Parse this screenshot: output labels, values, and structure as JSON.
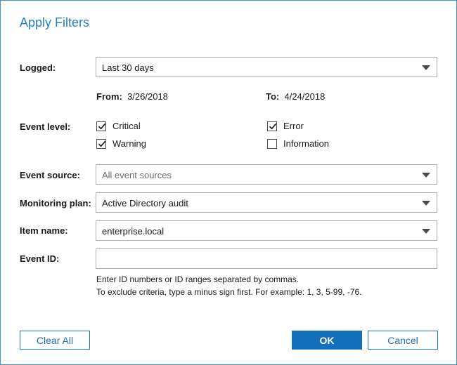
{
  "dialog": {
    "title": "Apply Filters"
  },
  "logged": {
    "label": "Logged:",
    "value": "Last 30 days",
    "from_label": "From:",
    "from_value": "3/26/2018",
    "to_label": "To:",
    "to_value": "4/24/2018"
  },
  "event_level": {
    "label": "Event level:",
    "options": [
      {
        "label": "Critical",
        "checked": true
      },
      {
        "label": "Warning",
        "checked": true
      },
      {
        "label": "Error",
        "checked": true
      },
      {
        "label": "Information",
        "checked": false
      }
    ]
  },
  "event_source": {
    "label": "Event source:",
    "value": "All event sources"
  },
  "monitoring_plan": {
    "label": "Monitoring plan:",
    "value": "Active Directory audit"
  },
  "item_name": {
    "label": "Item name:",
    "value": "enterprise.local"
  },
  "event_id": {
    "label": "Event ID:",
    "value": "",
    "hint_line1": "Enter ID numbers or ID ranges separated by commas.",
    "hint_line2": "To exclude criteria, type a minus sign first. For example: 1, 3, 5-99, -76."
  },
  "buttons": {
    "clear_all": "Clear All",
    "ok": "OK",
    "cancel": "Cancel"
  },
  "colors": {
    "accent": "#1470bd",
    "title": "#2a7fc1",
    "border": "#3a96d8"
  }
}
